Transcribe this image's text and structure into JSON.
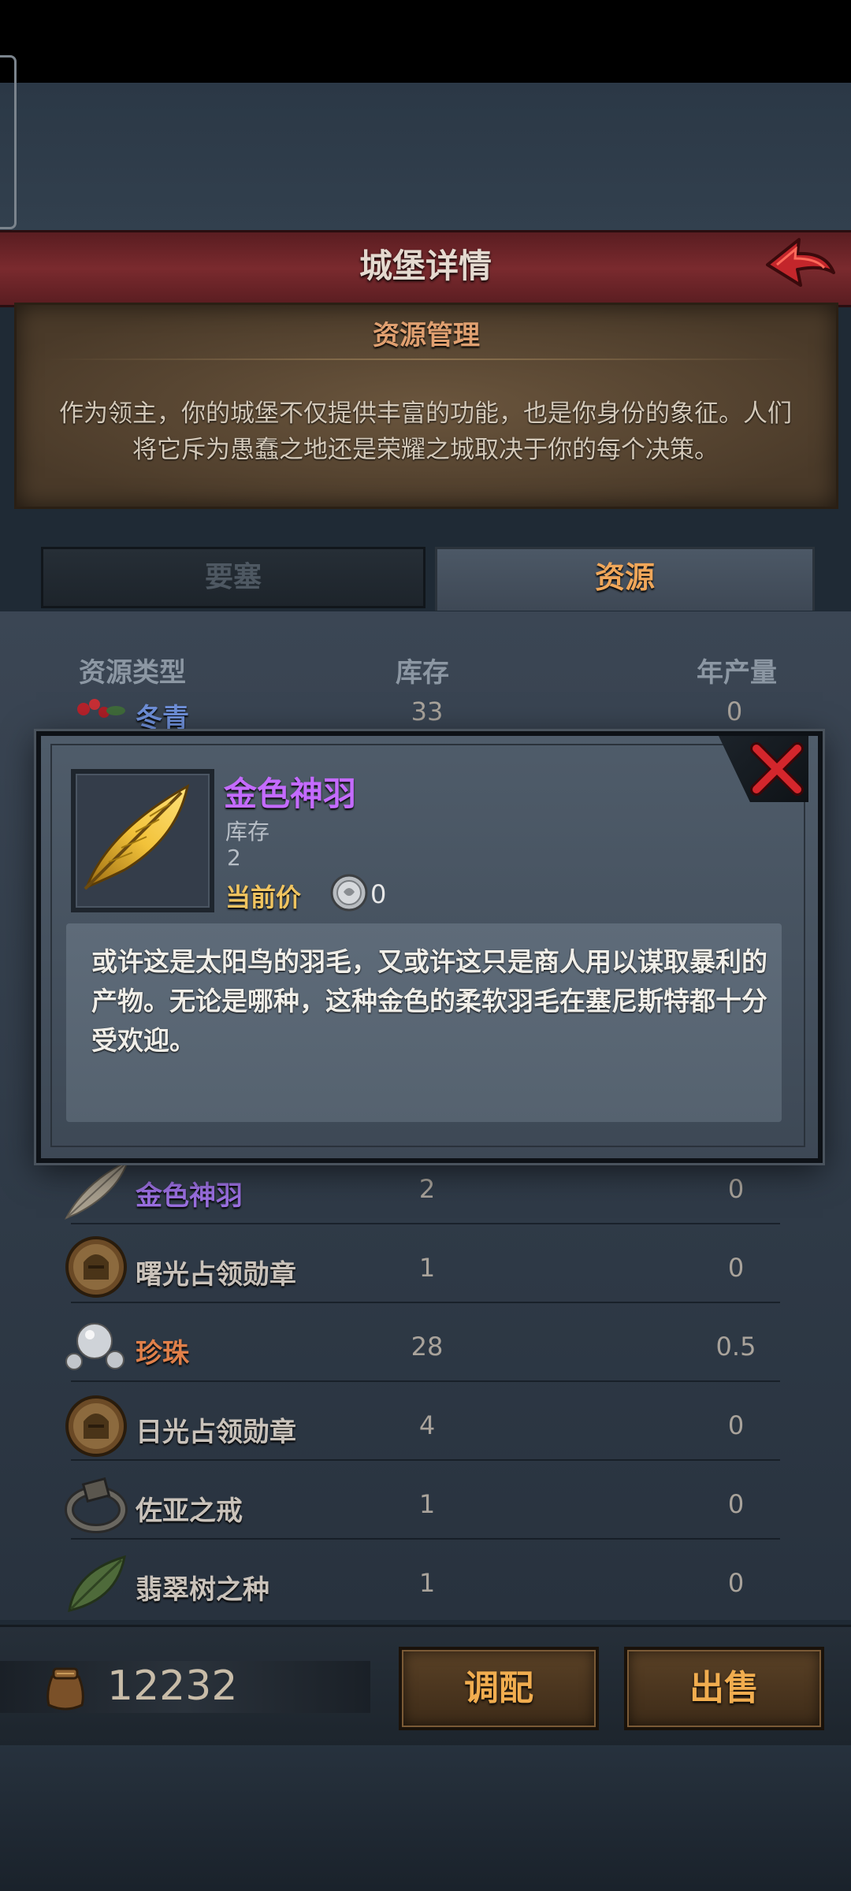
{
  "header": {
    "title": "城堡详情"
  },
  "info_panel": {
    "title": "资源管理",
    "description": "作为领主，你的城堡不仅提供丰富的功能，也是你身份的象征。人们将它斥为愚蠢之地还是荣耀之城取决于你的每个决策。"
  },
  "tabs": [
    {
      "label": "要塞",
      "active": false
    },
    {
      "label": "资源",
      "active": true
    }
  ],
  "table": {
    "columns": [
      "资源类型",
      "库存",
      "年产量"
    ],
    "rows": [
      {
        "name": "冬青",
        "stock": "33",
        "yield": "0",
        "icon": "holly-icon",
        "name_color": "#6e8fd8"
      },
      {
        "name": "金色神羽",
        "stock": "2",
        "yield": "0",
        "icon": "golden-feather-icon",
        "name_color": "#9a6fe0"
      },
      {
        "name": "曙光占领勋章",
        "stock": "1",
        "yield": "0",
        "icon": "helmet-medal-icon",
        "name_color": "#c9c2ba"
      },
      {
        "name": "珍珠",
        "stock": "28",
        "yield": "0.5",
        "icon": "pearls-icon",
        "name_color": "#e0804a"
      },
      {
        "name": "日光占领勋章",
        "stock": "4",
        "yield": "0",
        "icon": "helmet-medal-icon",
        "name_color": "#c9c2ba"
      },
      {
        "name": "佐亚之戒",
        "stock": "1",
        "yield": "0",
        "icon": "ring-icon",
        "name_color": "#c9c2ba"
      },
      {
        "name": "翡翠树之种",
        "stock": "1",
        "yield": "0",
        "icon": "leaf-seed-icon",
        "name_color": "#c9c2ba"
      }
    ]
  },
  "popup": {
    "item_name": "金色神羽",
    "stock_label": "库存",
    "stock_value": "2",
    "price_label": "当前价",
    "price_value": "0",
    "description": "或许这是太阳鸟的羽毛，又或许这只是商人用以谋取暴利的产物。无论是哪种，这种金色的柔软羽毛在塞尼斯特都十分受欢迎。"
  },
  "footer": {
    "gold_amount": "12232",
    "allocate_label": "调配",
    "sell_label": "出售"
  },
  "colors": {
    "accent_orange": "#f0a75a",
    "header_red": "#7a2a2e",
    "item_purple": "#c46bff"
  }
}
